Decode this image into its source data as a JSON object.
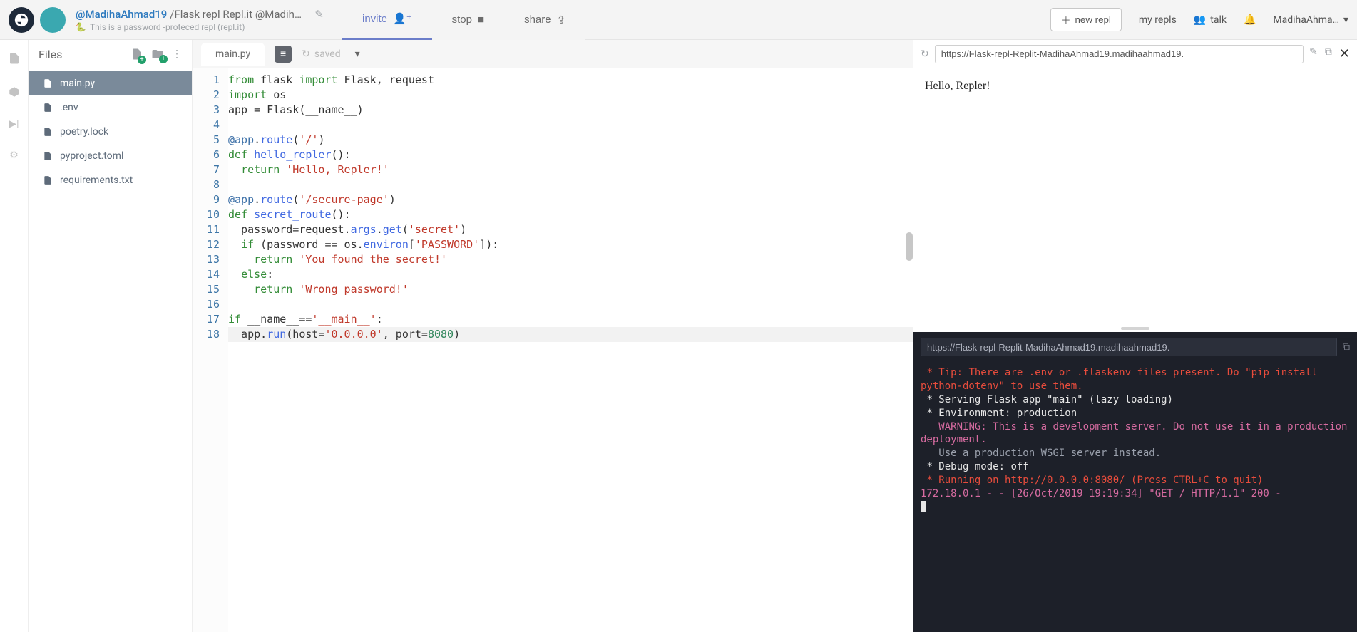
{
  "header": {
    "user": "@MadihaAhmad19",
    "repl_name": "/Flask repl Repl.it @MadihaAh…",
    "sub_text": "This is a password -proteced repl (repl.it)",
    "invite": "invite",
    "stop": "stop",
    "share": "share",
    "new_repl": "new repl",
    "my_repls": "my repls",
    "talk": "talk",
    "account": "MadihaAhma…"
  },
  "files": {
    "title": "Files",
    "items": [
      {
        "name": "main.py",
        "active": true
      },
      {
        "name": ".env",
        "active": false
      },
      {
        "name": "poetry.lock",
        "active": false
      },
      {
        "name": "pyproject.toml",
        "active": false
      },
      {
        "name": "requirements.txt",
        "active": false
      }
    ]
  },
  "editor": {
    "tab": "main.py",
    "saved": "saved",
    "lines": 18,
    "code": [
      [
        [
          "kw",
          "from"
        ],
        [
          "",
          " flask "
        ],
        [
          "kw",
          "import"
        ],
        [
          "",
          " Flask, request"
        ]
      ],
      [
        [
          "kw",
          "import"
        ],
        [
          "",
          " os"
        ]
      ],
      [
        [
          "",
          "app = Flask(__name__)"
        ]
      ],
      [
        [
          "",
          ""
        ]
      ],
      [
        [
          "dec",
          "@app"
        ],
        [
          "",
          "."
        ],
        [
          "fn",
          "route"
        ],
        [
          "",
          "("
        ],
        [
          "str",
          "'/'"
        ],
        [
          "",
          ")"
        ]
      ],
      [
        [
          "kw",
          "def"
        ],
        [
          "",
          " "
        ],
        [
          "fn",
          "hello_repler"
        ],
        [
          "",
          "():"
        ]
      ],
      [
        [
          "",
          "  "
        ],
        [
          "kw",
          "return"
        ],
        [
          "",
          " "
        ],
        [
          "str",
          "'Hello, Repler!'"
        ]
      ],
      [
        [
          "",
          ""
        ]
      ],
      [
        [
          "dec",
          "@app"
        ],
        [
          "",
          "."
        ],
        [
          "fn",
          "route"
        ],
        [
          "",
          "("
        ],
        [
          "str",
          "'/secure-page'"
        ],
        [
          "",
          ")"
        ]
      ],
      [
        [
          "kw",
          "def"
        ],
        [
          "",
          " "
        ],
        [
          "fn",
          "secret_route"
        ],
        [
          "",
          "():"
        ]
      ],
      [
        [
          "",
          "  password=request."
        ],
        [
          "fn",
          "args"
        ],
        [
          "",
          "."
        ],
        [
          "fn",
          "get"
        ],
        [
          "",
          "("
        ],
        [
          "str",
          "'secret'"
        ],
        [
          "",
          ")"
        ]
      ],
      [
        [
          "",
          "  "
        ],
        [
          "kw",
          "if"
        ],
        [
          "",
          " (password == os."
        ],
        [
          "fn",
          "environ"
        ],
        [
          "",
          "["
        ],
        [
          "str",
          "'PASSWORD'"
        ],
        [
          "",
          "]):"
        ]
      ],
      [
        [
          "",
          "    "
        ],
        [
          "kw",
          "return"
        ],
        [
          "",
          " "
        ],
        [
          "str",
          "'You found the secret!'"
        ]
      ],
      [
        [
          "",
          "  "
        ],
        [
          "kw",
          "else"
        ],
        [
          "",
          ":"
        ]
      ],
      [
        [
          "",
          "    "
        ],
        [
          "kw",
          "return"
        ],
        [
          "",
          " "
        ],
        [
          "str",
          "'Wrong password!'"
        ]
      ],
      [
        [
          "",
          ""
        ]
      ],
      [
        [
          "kw",
          "if"
        ],
        [
          "",
          " __name__=="
        ],
        [
          "str",
          "'__main__'"
        ],
        [
          "",
          ":"
        ]
      ],
      [
        [
          "",
          "  app."
        ],
        [
          "fn",
          "run"
        ],
        [
          "",
          "(host="
        ],
        [
          "str",
          "'0.0.0.0'"
        ],
        [
          "",
          ", port="
        ],
        [
          "num",
          "8080"
        ],
        [
          "",
          ")"
        ]
      ]
    ]
  },
  "preview": {
    "url": "https://Flask-repl-Replit-MadihaAhmad19.madihaahmad19.",
    "body": "Hello, Repler!"
  },
  "console": {
    "url": "https://Flask-repl-Replit-MadihaAhmad19.madihaahmad19.",
    "lines": [
      {
        "cls": "c-red",
        "text": " * Tip: There are .env or .flaskenv files present. Do \"pip install python-dotenv\" to use them."
      },
      {
        "cls": "c-white",
        "text": " * Serving Flask app \"main\" (lazy loading)"
      },
      {
        "cls": "c-white",
        "text": " * Environment: production"
      },
      {
        "cls": "c-pink",
        "text": "   WARNING: This is a development server. Do not use it in a production deployment."
      },
      {
        "cls": "c-gray",
        "text": "   Use a production WSGI server instead."
      },
      {
        "cls": "c-white",
        "text": " * Debug mode: off"
      },
      {
        "cls": "c-red",
        "text": " * Running on http://0.0.0.0:8080/ (Press CTRL+C to quit)"
      },
      {
        "cls": "c-pink",
        "text": "172.18.0.1 - - [26/Oct/2019 19:19:34] \"GET / HTTP/1.1\" 200 -"
      }
    ]
  }
}
